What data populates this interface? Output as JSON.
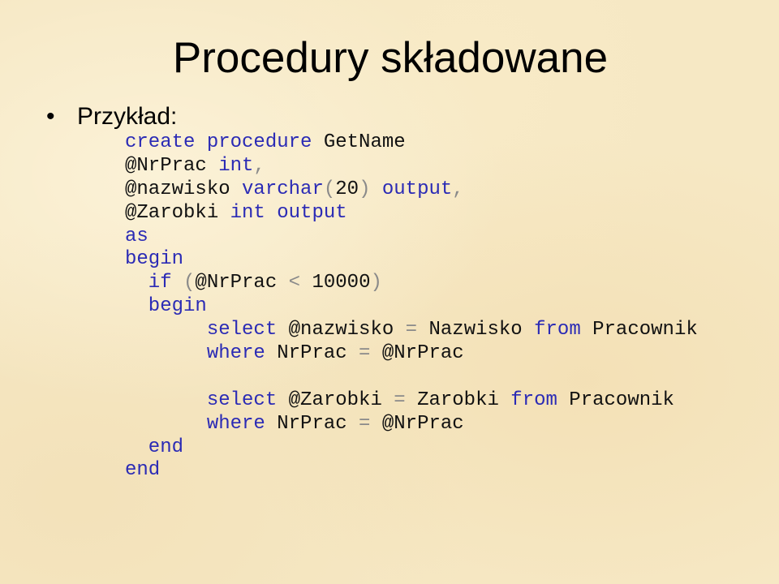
{
  "slide": {
    "title": "Procedury składowane",
    "bullet": "Przykład:",
    "colors": {
      "keyword": "#2b2bb5",
      "identifier": "#111111",
      "operator": "#8a8a8a",
      "background": "#f6e8c4"
    },
    "code_lines": [
      [
        {
          "t": "create procedure",
          "c": "kw"
        },
        {
          "t": " GetName",
          "c": "id"
        }
      ],
      [
        {
          "t": "@NrPrac",
          "c": "id"
        },
        {
          "t": " int",
          "c": "kw"
        },
        {
          "t": ",",
          "c": "op"
        }
      ],
      [
        {
          "t": "@nazwisko",
          "c": "id"
        },
        {
          "t": " varchar",
          "c": "kw"
        },
        {
          "t": "(",
          "c": "op"
        },
        {
          "t": "20",
          "c": "id"
        },
        {
          "t": ")",
          "c": "op"
        },
        {
          "t": " output",
          "c": "kw"
        },
        {
          "t": ",",
          "c": "op"
        }
      ],
      [
        {
          "t": "@Zarobki",
          "c": "id"
        },
        {
          "t": " int output",
          "c": "kw"
        }
      ],
      [
        {
          "t": "as",
          "c": "kw"
        }
      ],
      [
        {
          "t": "begin",
          "c": "kw"
        }
      ],
      [
        {
          "t": "  if",
          "c": "kw"
        },
        {
          "t": " (",
          "c": "op"
        },
        {
          "t": "@NrPrac",
          "c": "id"
        },
        {
          "t": " <",
          "c": "op"
        },
        {
          "t": " 10000",
          "c": "id"
        },
        {
          "t": ")",
          "c": "op"
        }
      ],
      [
        {
          "t": "  begin",
          "c": "kw"
        }
      ],
      [
        {
          "t": "       select",
          "c": "kw"
        },
        {
          "t": " @nazwisko",
          "c": "id"
        },
        {
          "t": " =",
          "c": "op"
        },
        {
          "t": " Nazwisko",
          "c": "id"
        },
        {
          "t": " from",
          "c": "kw"
        },
        {
          "t": " Pracownik",
          "c": "id"
        }
      ],
      [
        {
          "t": "       where",
          "c": "kw"
        },
        {
          "t": " NrPrac",
          "c": "id"
        },
        {
          "t": " =",
          "c": "op"
        },
        {
          "t": " @NrPrac",
          "c": "id"
        }
      ],
      [],
      [
        {
          "t": "       select",
          "c": "kw"
        },
        {
          "t": " @Zarobki",
          "c": "id"
        },
        {
          "t": " =",
          "c": "op"
        },
        {
          "t": " Zarobki",
          "c": "id"
        },
        {
          "t": " from",
          "c": "kw"
        },
        {
          "t": " Pracownik",
          "c": "id"
        }
      ],
      [
        {
          "t": "       where",
          "c": "kw"
        },
        {
          "t": " NrPrac",
          "c": "id"
        },
        {
          "t": " =",
          "c": "op"
        },
        {
          "t": " @NrPrac",
          "c": "id"
        }
      ],
      [
        {
          "t": "  end",
          "c": "kw"
        }
      ],
      [
        {
          "t": "end",
          "c": "kw"
        }
      ]
    ]
  }
}
